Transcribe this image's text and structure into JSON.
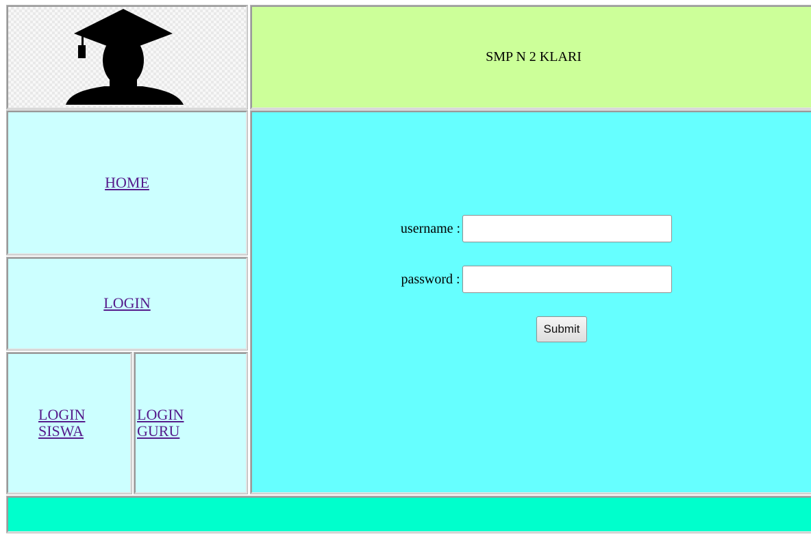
{
  "header": {
    "title": "SMP N 2 KLARI"
  },
  "logo": {
    "icon": "graduate-silhouette-icon"
  },
  "menu": {
    "home": "HOME",
    "login": "LOGIN",
    "login_siswa": "LOGIN SISWA",
    "login_guru": "LOGIN GURU"
  },
  "form": {
    "username_label": "username :",
    "username_value": "",
    "password_label": "password :",
    "password_value": "",
    "submit_label": "Submit"
  },
  "colors": {
    "header_bg": "#ccff99",
    "menu_bg": "#ccffff",
    "content_bg": "#66ffff",
    "footer_bg": "#00ffcc",
    "link": "#551a8b"
  }
}
